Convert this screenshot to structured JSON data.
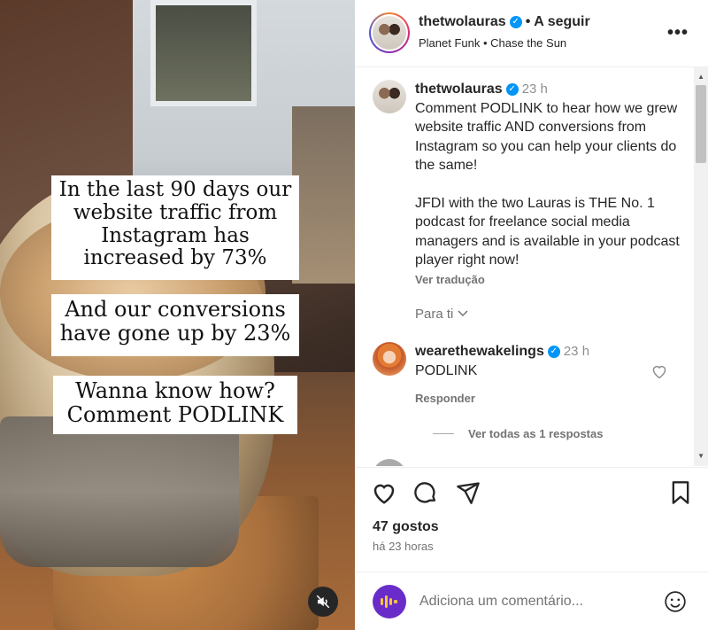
{
  "media": {
    "caption1": "In the last 90 days our website traffic from Instagram has increased by 73%",
    "caption2": "And our conversions have gone up by 23%",
    "caption3": "Wanna know how? Comment PODLINK"
  },
  "header": {
    "username": "thetwolauras",
    "separator": "•",
    "follow_label": "A seguir",
    "music": "Planet Funk • Chase the Sun"
  },
  "post": {
    "username": "thetwolauras",
    "time": "23 h",
    "text1": "Comment PODLINK to hear how we grew website traffic AND conversions from Instagram so you can help your clients do the same!",
    "text2": "JFDI with the two Lauras is THE No. 1 podcast for freelance social media managers and is available in your podcast player right now!",
    "translate": "Ver tradução",
    "for_you": "Para ti"
  },
  "comment": {
    "username": "wearethewakelings",
    "time": "23 h",
    "text": "PODLINK",
    "reply": "Responder",
    "view_all": "Ver todas as 1 respostas"
  },
  "next_comment": {
    "username": ""
  },
  "footer": {
    "likes": "47 gostos",
    "time_ago": "há 23 horas",
    "add_comment_placeholder": "Adiciona um comentário..."
  },
  "colors": {
    "verified": "#0095f6",
    "accent": "#0095f6",
    "badge": "#6a2cc8"
  }
}
